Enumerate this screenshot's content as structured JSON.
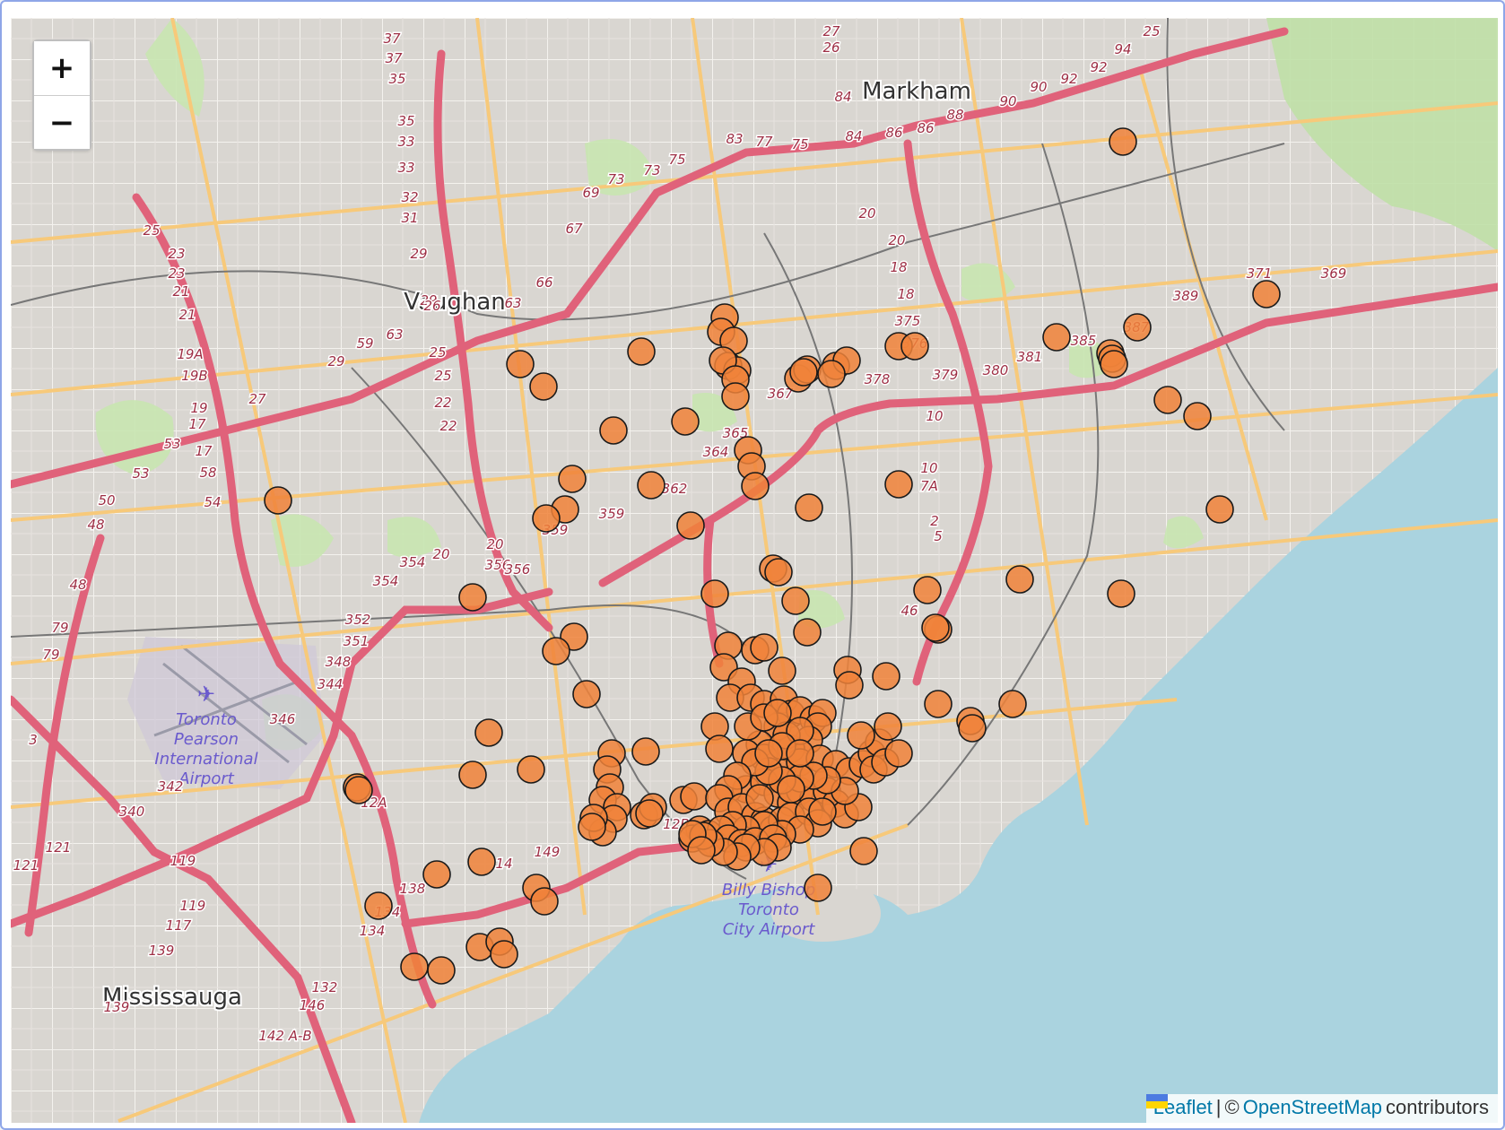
{
  "zoom": {
    "in_label": "+",
    "out_label": "−"
  },
  "attribution": {
    "leaflet": "Leaflet",
    "sep": "|",
    "copy": "©",
    "osm": "OpenStreetMap",
    "suffix": "contributors"
  },
  "places": {
    "markham": "Markham",
    "vaughan": "Vaughan",
    "mississauga": "Mississauga",
    "pearson": [
      "Toronto",
      "Pearson",
      "International",
      "Airport"
    ],
    "billy_bishop": [
      "Billy Bishop",
      "Toronto",
      "City Airport"
    ]
  },
  "exit_labels": [
    "37",
    "37",
    "35",
    "35",
    "33",
    "33",
    "32",
    "31",
    "29",
    "29",
    "27",
    "26",
    "84",
    "84",
    "86",
    "86",
    "88",
    "90",
    "90",
    "92",
    "92",
    "94",
    "25",
    "25",
    "23",
    "23",
    "21",
    "21",
    "19A",
    "19B",
    "19",
    "17",
    "17",
    "58",
    "54",
    "53",
    "53",
    "50",
    "48",
    "48",
    "79",
    "79",
    "83",
    "77",
    "75",
    "75",
    "73",
    "73",
    "69",
    "67",
    "66",
    "63",
    "63",
    "59",
    "29",
    "27",
    "26",
    "25",
    "25",
    "22",
    "22",
    "20",
    "20",
    "18",
    "18",
    "375",
    "376",
    "378",
    "379",
    "380",
    "381",
    "385",
    "387",
    "389",
    "371",
    "369",
    "367",
    "365",
    "364",
    "362",
    "359",
    "359",
    "20",
    "20",
    "356",
    "356",
    "354",
    "354",
    "352",
    "351",
    "348",
    "344",
    "346",
    "342",
    "340",
    "121",
    "121",
    "119",
    "119",
    "117",
    "139",
    "139",
    "138",
    "134",
    "134",
    "132",
    "146",
    "142 A-B",
    "149",
    "14",
    "12B",
    "12A",
    "10",
    "10",
    "7A",
    "2",
    "5",
    "46",
    "3"
  ],
  "marker_style": {
    "fill": "#f0823a",
    "stroke": "#1a1a1a"
  },
  "colors": {
    "water": "#aad3df",
    "land": "#d9d6d1",
    "highway": "#e8899b",
    "arterial": "#f7c97a",
    "park": "#c8e6b0"
  }
}
